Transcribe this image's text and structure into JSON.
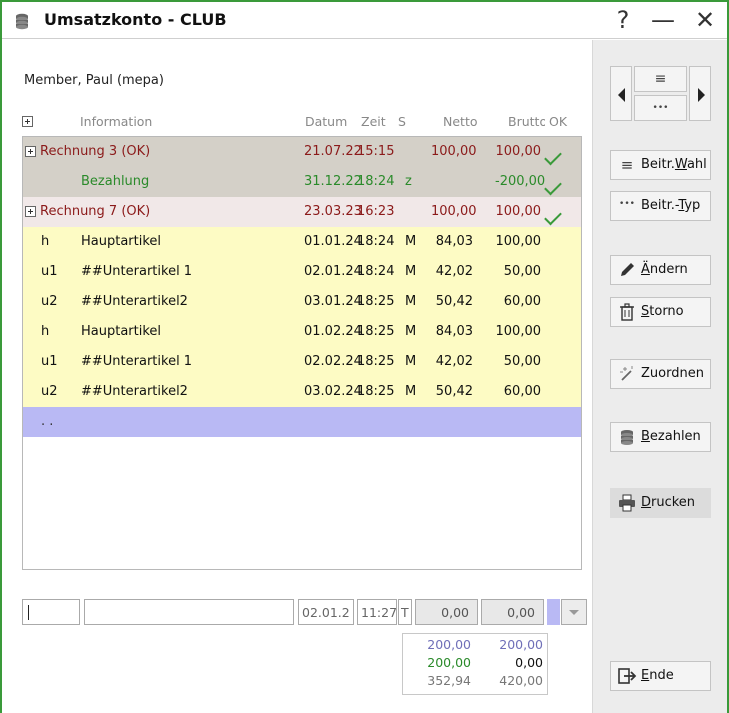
{
  "window": {
    "title": "Umsatzkonto - CLUB",
    "help_glyph": "?",
    "minimize_glyph": "—",
    "close_glyph": "✕"
  },
  "member": "Member, Paul (mepa)",
  "columns": {
    "info": "Information",
    "date": "Datum",
    "time": "Zeit",
    "s": "S",
    "net": "Netto",
    "gross": "Brutto",
    "ok": "OK"
  },
  "rows": [
    {
      "code": "",
      "info": "Rechnung 3 (OK)",
      "date": "21.07.22",
      "time": "15:15",
      "s": "",
      "net": "100,00",
      "gross": "100,00",
      "ok": true,
      "kind": "invoice",
      "bg": "#d4d0c8",
      "color": "#8b1a1a"
    },
    {
      "code": "",
      "info": "Bezahlung",
      "date": "31.12.22",
      "time": "18:24",
      "s": "z",
      "net": "",
      "gross": "-200,00",
      "ok": true,
      "kind": "payment",
      "bg": "#d4d0c8",
      "color": "#2a8a2a"
    },
    {
      "code": "",
      "info": "Rechnung 7 (OK)",
      "date": "23.03.23",
      "time": "16:23",
      "s": "",
      "net": "100,00",
      "gross": "100,00",
      "ok": true,
      "kind": "invoice",
      "bg": "#f1e8e8",
      "color": "#8b1a1a"
    },
    {
      "code": "h",
      "info": "Hauptartikel",
      "date": "01.01.24",
      "time": "18:24",
      "s": "M",
      "net": "84,03",
      "gross": "100,00",
      "ok": false,
      "kind": "item",
      "bg": "#fdfbc4",
      "color": "#111"
    },
    {
      "code": "u1",
      "info": "##Unterartikel 1",
      "date": "02.01.24",
      "time": "18:24",
      "s": "M",
      "net": "42,02",
      "gross": "50,00",
      "ok": false,
      "kind": "item",
      "bg": "#fdfbc4",
      "color": "#111"
    },
    {
      "code": "u2",
      "info": "##Unterartikel2",
      "date": "03.01.24",
      "time": "18:25",
      "s": "M",
      "net": "50,42",
      "gross": "60,00",
      "ok": false,
      "kind": "item",
      "bg": "#fdfbc4",
      "color": "#111"
    },
    {
      "code": "h",
      "info": "Hauptartikel",
      "date": "01.02.24",
      "time": "18:25",
      "s": "M",
      "net": "84,03",
      "gross": "100,00",
      "ok": false,
      "kind": "item",
      "bg": "#fdfbc4",
      "color": "#111"
    },
    {
      "code": "u1",
      "info": "##Unterartikel 1",
      "date": "02.02.24",
      "time": "18:25",
      "s": "M",
      "net": "42,02",
      "gross": "50,00",
      "ok": false,
      "kind": "item",
      "bg": "#fdfbc4",
      "color": "#111"
    },
    {
      "code": "u2",
      "info": "##Unterartikel2",
      "date": "03.02.24",
      "time": "18:25",
      "s": "M",
      "net": "50,42",
      "gross": "60,00",
      "ok": false,
      "kind": "item",
      "bg": "#fdfbc4",
      "color": "#111"
    },
    {
      "code": ". .",
      "info": "",
      "date": "",
      "time": "",
      "s": "",
      "net": "",
      "gross": "",
      "ok": false,
      "kind": "new",
      "bg": "#b9b9f4",
      "color": "#333"
    }
  ],
  "edit": {
    "code_value": "",
    "info_value": "",
    "date_value": "02.01.2",
    "time_value": "11:27",
    "s_value": "T",
    "net_value": "0,00",
    "gross_value": "0,00"
  },
  "totals": {
    "r1_net": "200,00",
    "r1_gross": "200,00",
    "r2_net": "200,00",
    "r2_gross": "0,00",
    "r3_net": "352,94",
    "r3_gross": "420,00"
  },
  "sidebar": {
    "nav_menu_glyph": "≡",
    "nav_more_glyph": "•••",
    "beitr_wahl_pre": "Beitr.",
    "beitr_wahl_u": "W",
    "beitr_wahl_post": "ahl",
    "beitr_typ_pre": "Beitr.-",
    "beitr_typ_u": "T",
    "beitr_typ_post": "yp",
    "aendern_pre": "",
    "aendern_u": "Ä",
    "aendern_post": "ndern",
    "storno_pre": "",
    "storno_u": "S",
    "storno_post": "torno",
    "zuordnen": "Zuordnen",
    "bezahlen_pre": "",
    "bezahlen_u": "B",
    "bezahlen_post": "ezahlen",
    "drucken_pre": "",
    "drucken_u": "D",
    "drucken_post": "rucken",
    "ende_pre": "",
    "ende_u": "E",
    "ende_post": "nde"
  },
  "colors": {
    "accent": "#3a9a3a",
    "invoice_text": "#8b1a1a",
    "payment_text": "#2a8a2a",
    "total_blue": "#6f6fb8",
    "total_green": "#2a8a2a"
  },
  "icons": {
    "title": "coins-icon",
    "wahl": "list-icon",
    "typ": "dots-icon",
    "aendern": "pencil-icon",
    "storno": "trash-icon",
    "zuordnen": "magic-wand-icon",
    "bezahlen": "coins-icon",
    "drucken": "printer-icon",
    "ende": "exit-icon"
  }
}
